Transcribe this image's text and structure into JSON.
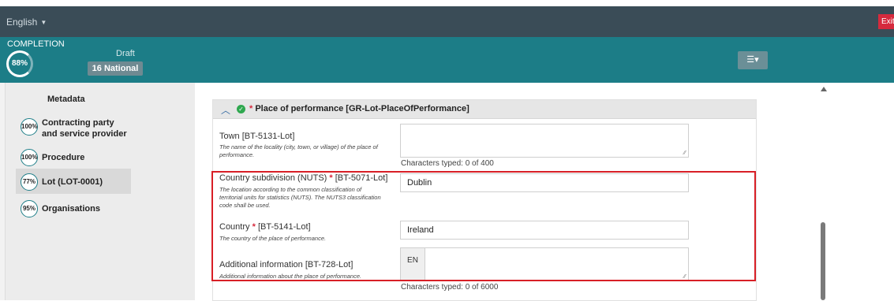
{
  "topbar": {
    "language": "English",
    "exit_label": "Exit"
  },
  "completion": {
    "label": "COMPLETION",
    "percent": "88%",
    "status": "Draft",
    "badge": "16 National"
  },
  "sidebar": {
    "heading": "Metadata",
    "items": [
      {
        "percent": "100%",
        "label": "Contracting party and service provider"
      },
      {
        "percent": "100%",
        "label": "Procedure"
      },
      {
        "percent": "77%",
        "label": "Lot (LOT-0001)",
        "active": true
      },
      {
        "percent": "95%",
        "label": "Organisations"
      }
    ]
  },
  "section": {
    "title": "Place of performance  [GR-Lot-PlaceOfPerformance]",
    "fields": {
      "town": {
        "label": "Town [BT-5131-Lot]",
        "desc": "The name of the locality (city, town, or village) of the place of performance.",
        "value": "",
        "counter": "Characters typed: 0 of 400"
      },
      "nuts": {
        "label": "Country subdivision (NUTS)",
        "code": "[BT-5071-Lot]",
        "desc": "The location according to the common classification of territorial units for statistics (NUTS). The NUTS3 classification code shall be used.",
        "value": "Dublin"
      },
      "country": {
        "label": "Country",
        "code": "[BT-5141-Lot]",
        "desc": "The country of the place of performance.",
        "value": "Ireland"
      },
      "additional": {
        "label": "Additional information [BT-728-Lot]",
        "desc": "Additional information about the place of performance.",
        "lang": "EN",
        "value": "",
        "counter": "Characters typed: 0 of 6000"
      }
    }
  },
  "colors": {
    "topbar": "#3a4c57",
    "band": "#1c7d87",
    "highlight": "#d81f26",
    "exit": "#d62a3d",
    "check": "#2fa84f"
  }
}
